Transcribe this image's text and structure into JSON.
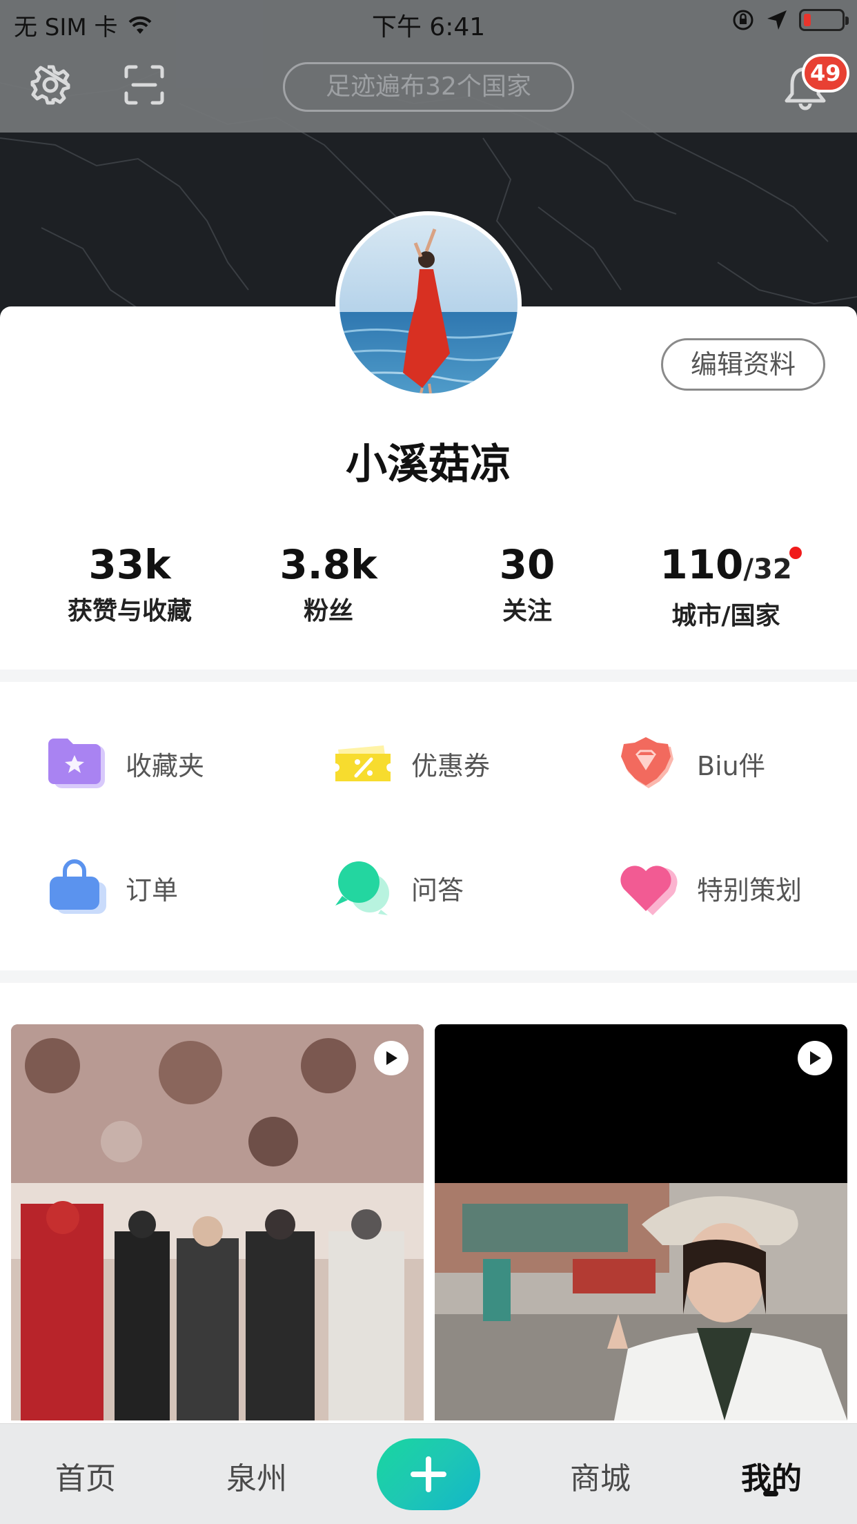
{
  "status_bar": {
    "carrier": "无 SIM 卡",
    "time": "下午 6:41"
  },
  "header": {
    "footprint": "足迹遍布32个国家",
    "notification_count": "49"
  },
  "profile": {
    "edit_button": "编辑资料",
    "name": "小溪菇凉",
    "stats": [
      {
        "value": "33k",
        "label": "获赞与收藏"
      },
      {
        "value": "3.8k",
        "label": "粉丝"
      },
      {
        "value": "30",
        "label": "关注"
      },
      {
        "value": "110",
        "sub": "/32",
        "label": "城市/国家",
        "has_dot": true
      }
    ]
  },
  "features": [
    {
      "label": "收藏夹",
      "icon": "folder-star-icon"
    },
    {
      "label": "优惠券",
      "icon": "coupon-icon"
    },
    {
      "label": "Biu伴",
      "icon": "gem-icon"
    },
    {
      "label": "订单",
      "icon": "bag-icon"
    },
    {
      "label": "问答",
      "icon": "chat-bubbles-icon"
    },
    {
      "label": "特别策划",
      "icon": "heart-icon"
    }
  ],
  "tabbar": {
    "tabs": [
      "首页",
      "泉州",
      "商城",
      "我的"
    ],
    "active": "我的"
  },
  "colors": {
    "accent_gradient_start": "#19d6a0",
    "accent_gradient_end": "#12b6c9",
    "badge": "#e84033",
    "status_dot": "#f01b1b"
  }
}
